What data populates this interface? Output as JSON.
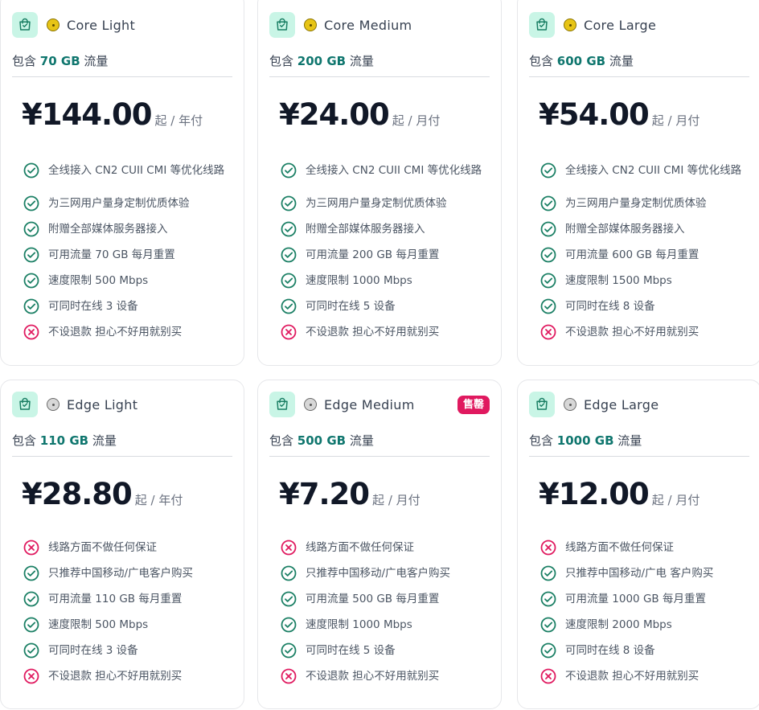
{
  "colors": {
    "accent": "#0f766e",
    "check": "#1a7f64",
    "cross": "#e0195f",
    "gold_dot": "#e7c416",
    "grey_dot": "#d7d7d7"
  },
  "plans": [
    {
      "name": "Core Light",
      "dot": "gold",
      "traffic_prefix": "包含",
      "traffic_amount": "70 GB",
      "traffic_suffix": "流量",
      "price": "¥144.00",
      "period": "起 / 年付",
      "badge": "",
      "features": [
        {
          "ok": true,
          "text": "全线接入 CN2 CUII CMI 等优化线路"
        },
        {
          "ok": true,
          "text": "为三网用户量身定制优质体验"
        },
        {
          "ok": true,
          "text": "附赠全部媒体服务器接入"
        },
        {
          "ok": true,
          "text": "可用流量 70 GB 每月重置"
        },
        {
          "ok": true,
          "text": "速度限制 500 Mbps"
        },
        {
          "ok": true,
          "text": "可同时在线 3 设备"
        },
        {
          "ok": false,
          "text": "不设退款 担心不好用就别买"
        }
      ]
    },
    {
      "name": "Core Medium",
      "dot": "gold",
      "traffic_prefix": "包含",
      "traffic_amount": "200 GB",
      "traffic_suffix": "流量",
      "price": "¥24.00",
      "period": "起 / 月付",
      "badge": "",
      "features": [
        {
          "ok": true,
          "text": "全线接入 CN2 CUII CMI 等优化线路"
        },
        {
          "ok": true,
          "text": "为三网用户量身定制优质体验"
        },
        {
          "ok": true,
          "text": "附赠全部媒体服务器接入"
        },
        {
          "ok": true,
          "text": "可用流量 200 GB 每月重置"
        },
        {
          "ok": true,
          "text": "速度限制 1000 Mbps"
        },
        {
          "ok": true,
          "text": "可同时在线 5 设备"
        },
        {
          "ok": false,
          "text": "不设退款 担心不好用就别买"
        }
      ]
    },
    {
      "name": "Core Large",
      "dot": "gold",
      "traffic_prefix": "包含",
      "traffic_amount": "600 GB",
      "traffic_suffix": "流量",
      "price": "¥54.00",
      "period": "起 / 月付",
      "badge": "",
      "features": [
        {
          "ok": true,
          "text": "全线接入 CN2 CUII CMI 等优化线路"
        },
        {
          "ok": true,
          "text": "为三网用户量身定制优质体验"
        },
        {
          "ok": true,
          "text": "附赠全部媒体服务器接入"
        },
        {
          "ok": true,
          "text": "可用流量 600 GB 每月重置"
        },
        {
          "ok": true,
          "text": "速度限制 1500 Mbps"
        },
        {
          "ok": true,
          "text": "可同时在线 8 设备"
        },
        {
          "ok": false,
          "text": "不设退款 担心不好用就别买"
        }
      ]
    },
    {
      "name": "Edge Light",
      "dot": "grey",
      "traffic_prefix": "包含",
      "traffic_amount": "110 GB",
      "traffic_suffix": "流量",
      "price": "¥28.80",
      "period": "起 / 年付",
      "badge": "",
      "features": [
        {
          "ok": false,
          "text": "线路方面不做任何保证"
        },
        {
          "ok": true,
          "text": "只推荐中国移动/广电客户购买"
        },
        {
          "ok": true,
          "text": "可用流量 110 GB 每月重置"
        },
        {
          "ok": true,
          "text": "速度限制 500 Mbps"
        },
        {
          "ok": true,
          "text": "可同时在线 3 设备"
        },
        {
          "ok": false,
          "text": "不设退款 担心不好用就别买"
        }
      ]
    },
    {
      "name": "Edge Medium",
      "dot": "grey",
      "traffic_prefix": "包含",
      "traffic_amount": "500 GB",
      "traffic_suffix": "流量",
      "price": "¥7.20",
      "period": "起 / 月付",
      "badge": "售罄",
      "features": [
        {
          "ok": false,
          "text": "线路方面不做任何保证"
        },
        {
          "ok": true,
          "text": "只推荐中国移动/广电客户购买"
        },
        {
          "ok": true,
          "text": "可用流量 500 GB 每月重置"
        },
        {
          "ok": true,
          "text": "速度限制 1000 Mbps"
        },
        {
          "ok": true,
          "text": "可同时在线 5 设备"
        },
        {
          "ok": false,
          "text": "不设退款 担心不好用就别买"
        }
      ]
    },
    {
      "name": "Edge Large",
      "dot": "grey",
      "traffic_prefix": "包含",
      "traffic_amount": "1000 GB",
      "traffic_suffix": "流量",
      "price": "¥12.00",
      "period": "起 / 月付",
      "badge": "",
      "features": [
        {
          "ok": false,
          "text": "线路方面不做任何保证"
        },
        {
          "ok": true,
          "text": "只推荐中国移动/广电 客户购买"
        },
        {
          "ok": true,
          "text": "可用流量 1000 GB 每月重置"
        },
        {
          "ok": true,
          "text": "速度限制 2000 Mbps"
        },
        {
          "ok": true,
          "text": "可同时在线 8 设备"
        },
        {
          "ok": false,
          "text": "不设退款 担心不好用就别买"
        }
      ]
    }
  ]
}
